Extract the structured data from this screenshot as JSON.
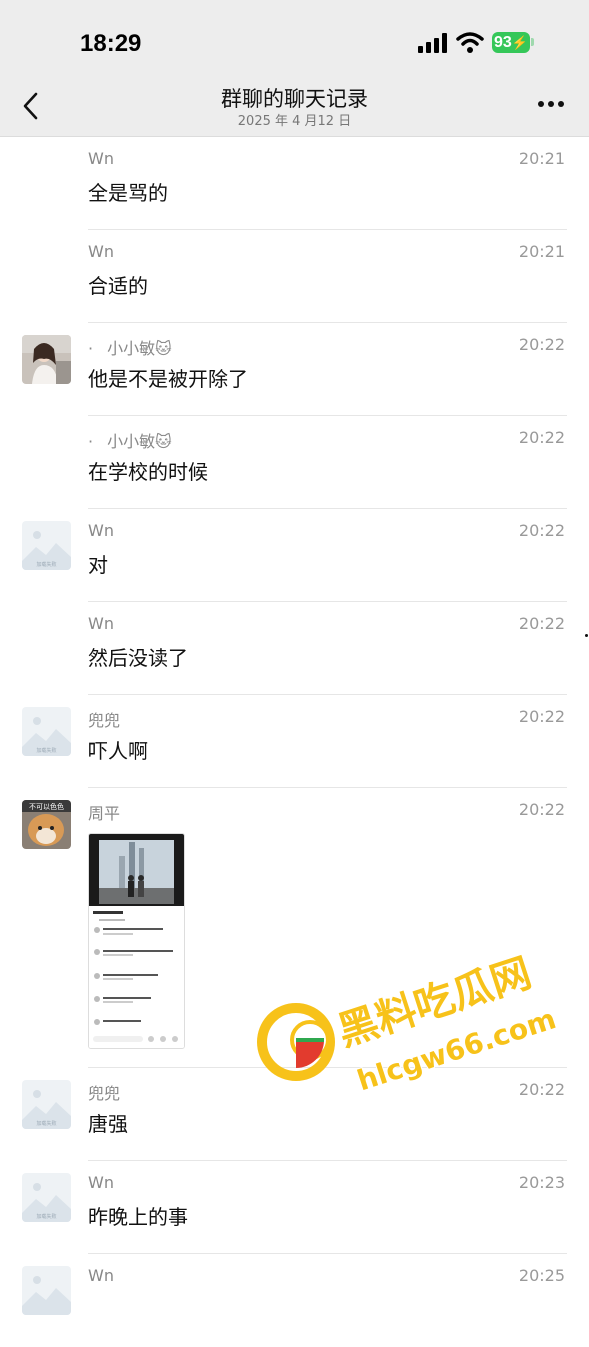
{
  "status": {
    "time": "18:29",
    "battery": "93"
  },
  "nav": {
    "title": "群聊的聊天记录",
    "subtitle": "2025 年 4 月12 日"
  },
  "messages": [
    {
      "sender": "Wn",
      "time": "20:21",
      "text": "全是骂的",
      "avatar": "none"
    },
    {
      "sender": "Wn",
      "time": "20:21",
      "text": "合适的",
      "avatar": "none"
    },
    {
      "sender": "小小敏🐱",
      "time": "20:22",
      "text": "他是不是被开除了",
      "avatar": "photo-girl",
      "dot": "·"
    },
    {
      "sender": "小小敏🐱",
      "time": "20:22",
      "text": "在学校的时候",
      "avatar": "none",
      "dot": "·"
    },
    {
      "sender": "Wn",
      "time": "20:22",
      "text": "对",
      "avatar": "placeholder"
    },
    {
      "sender": "Wn",
      "time": "20:22",
      "text": "然后没读了",
      "avatar": "none"
    },
    {
      "sender": "兜兜",
      "time": "20:22",
      "text": "吓人啊",
      "avatar": "placeholder"
    },
    {
      "sender": "周平",
      "time": "20:22",
      "text": "",
      "avatar": "dog",
      "image": "screenshot-image"
    },
    {
      "sender": "兜兜",
      "time": "20:22",
      "text": "唐强",
      "avatar": "placeholder"
    },
    {
      "sender": "Wn",
      "time": "20:23",
      "text": "昨晚上的事",
      "avatar": "placeholder"
    },
    {
      "sender": "Wn",
      "time": "20:25",
      "text": "",
      "avatar": "placeholder"
    }
  ],
  "avatar_labels": {
    "dog_caption": "不可以色色",
    "placeholder_caption": "加载失败"
  },
  "watermark": {
    "title": "黑料吃瓜网",
    "url": "hlcgw66.com"
  },
  "colors": {
    "battery": "#35c759",
    "watermark": "#f7c21a"
  }
}
